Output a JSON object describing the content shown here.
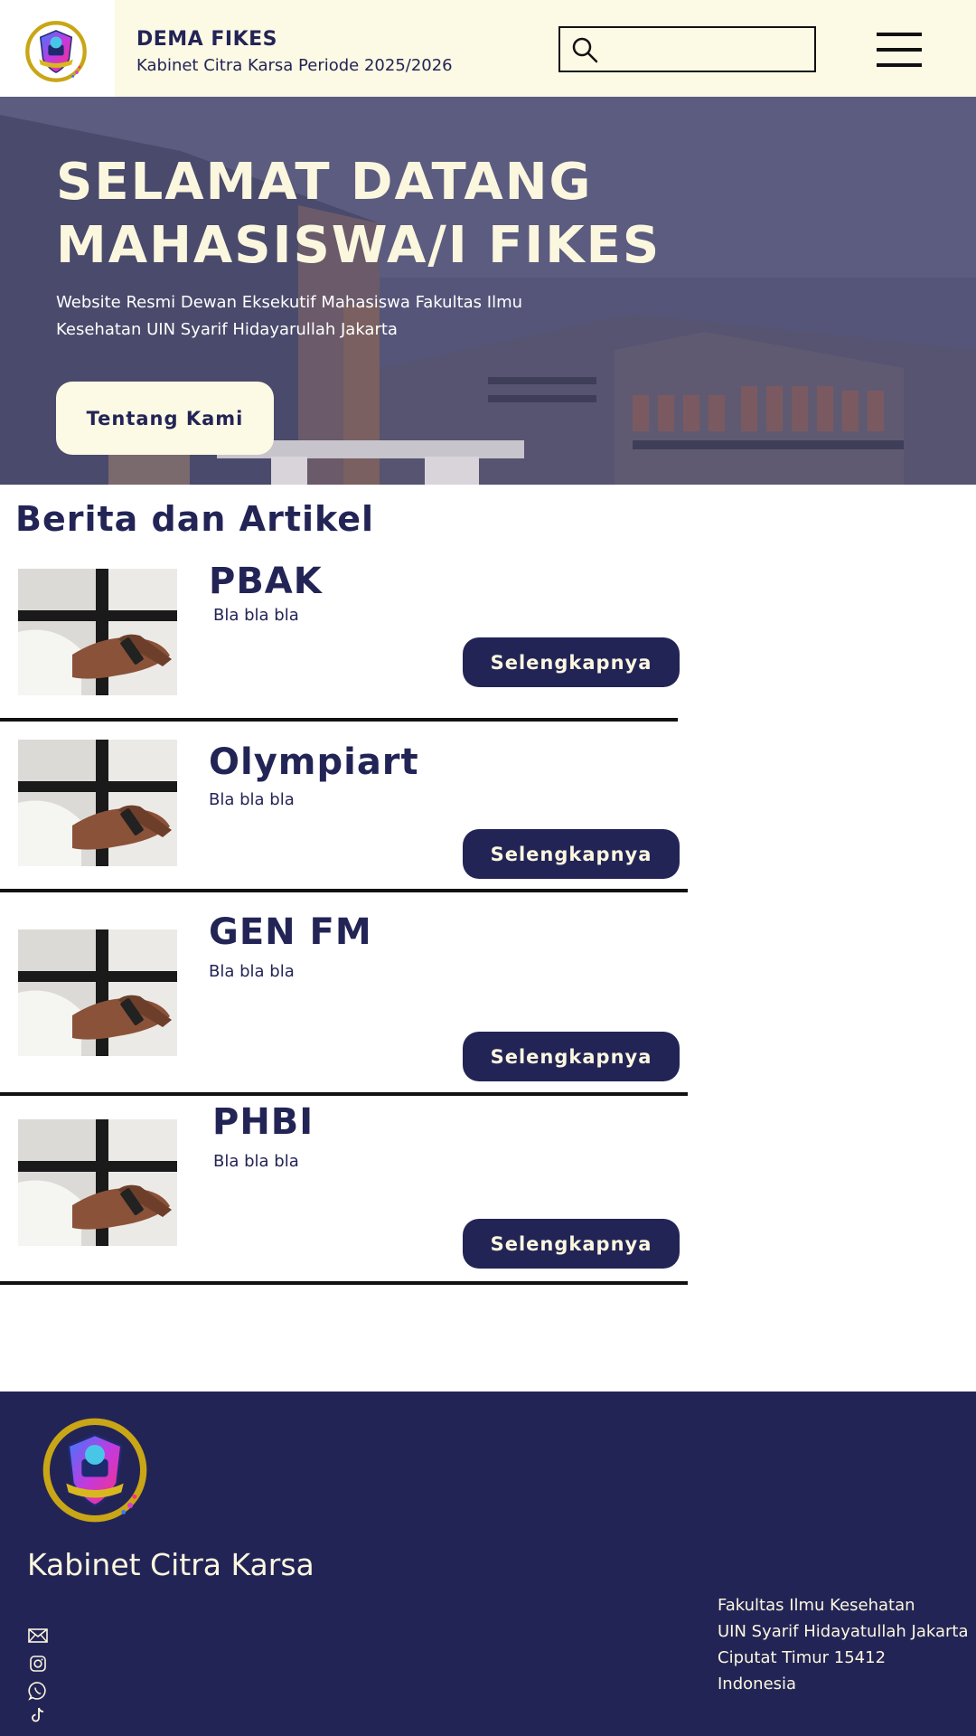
{
  "header": {
    "brand_title": "DEMA FIKES",
    "brand_subtitle": "Kabinet Citra Karsa Periode 2025/2026",
    "search_placeholder": "",
    "logo_icon": "dema-fikes-logo",
    "search_icon": "search-icon",
    "menu_icon": "hamburger-menu-icon"
  },
  "hero": {
    "title_line1": "SELAMAT DATANG",
    "title_line2": "MAHASISWA/I FIKES",
    "description": "Website Resmi Dewan Eksekutif Mahasiswa Fakultas Ilmu Kesehatan UIN Syarif Hidayarullah Jakarta",
    "button_label": "Tentang Kami"
  },
  "news": {
    "section_title": "Berita dan Artikel",
    "items": [
      {
        "title": "PBAK",
        "text": "Bla bla bla",
        "button_label": "Selengkapnya"
      },
      {
        "title": "Olympiart",
        "text": "Bla bla bla",
        "button_label": "Selengkapnya"
      },
      {
        "title": "GEN FM",
        "text": "Bla bla bla",
        "button_label": "Selengkapnya"
      },
      {
        "title": "PHBI",
        "text": "Bla bla bla",
        "button_label": "Selengkapnya"
      }
    ]
  },
  "footer": {
    "cabinet_name": "Kabinet Citra Karsa",
    "social_icons": [
      "mail-icon",
      "instagram-icon",
      "whatsapp-icon",
      "tiktok-icon"
    ],
    "address": {
      "line1": "Fakultas Ilmu Kesehatan",
      "line2": "UIN Syarif Hidayatullah Jakarta",
      "line3": "Ciputat Timur 15412",
      "line4": "Indonesia"
    }
  },
  "colors": {
    "navy": "#232456",
    "cream": "#fcf9e4",
    "hero_overlay": "#4e4e72"
  }
}
